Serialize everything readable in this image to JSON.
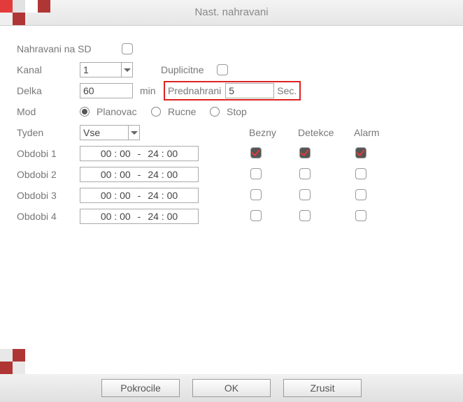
{
  "title": "Nast. nahravani",
  "labels": {
    "sd": "Nahravani na SD",
    "kanal": "Kanal",
    "dup": "Duplicitne",
    "delka": "Delka",
    "min": "min",
    "pred": "Prednahrani",
    "sec": "Sec.",
    "mod": "Mod",
    "plan": "Planovac",
    "rucne": "Rucne",
    "stop": "Stop",
    "tyden": "Tyden",
    "bezny": "Bezny",
    "detekce": "Detekce",
    "alarm": "Alarm"
  },
  "values": {
    "kanal": "1",
    "delka": "60",
    "pred": "5",
    "tyden": "Vse",
    "mod": "plan"
  },
  "periods": [
    {
      "label": "Obdobi 1",
      "from": "00 : 00",
      "to": "24 : 00",
      "bezny": true,
      "detekce": true,
      "alarm": true
    },
    {
      "label": "Obdobi 2",
      "from": "00 : 00",
      "to": "24 : 00",
      "bezny": false,
      "detekce": false,
      "alarm": false
    },
    {
      "label": "Obdobi 3",
      "from": "00 : 00",
      "to": "24 : 00",
      "bezny": false,
      "detekce": false,
      "alarm": false
    },
    {
      "label": "Obdobi 4",
      "from": "00 : 00",
      "to": "24 : 00",
      "bezny": false,
      "detekce": false,
      "alarm": false
    }
  ],
  "buttons": {
    "adv": "Pokrocile",
    "ok": "OK",
    "cancel": "Zrusit"
  }
}
